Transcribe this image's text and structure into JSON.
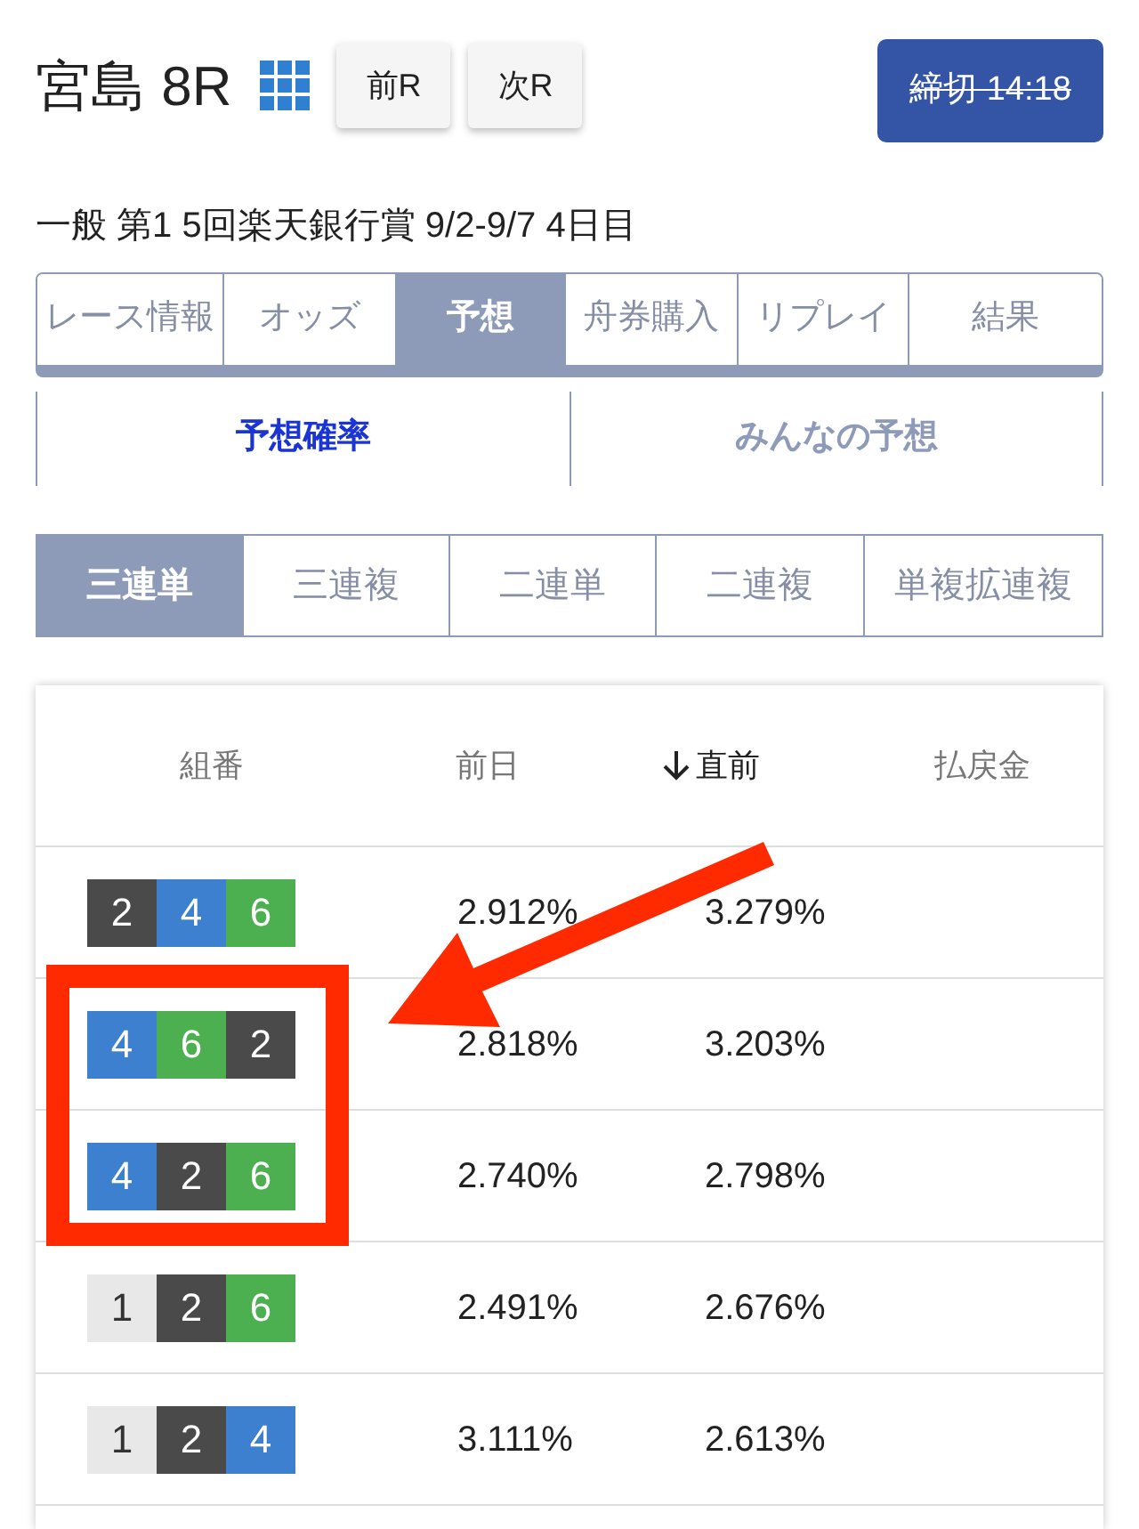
{
  "header": {
    "title": "宮島 8R",
    "nav_buttons": [
      "前R",
      "次R"
    ],
    "deadline": {
      "label": "締切 14:18",
      "closed": true
    }
  },
  "race_info": "一般 第1 5回楽天銀行賞 9/2-9/7 4日目",
  "tabs": [
    {
      "label": "レース情報",
      "selected": false
    },
    {
      "label": "オッズ",
      "selected": false
    },
    {
      "label": "予想",
      "selected": true
    },
    {
      "label": "舟券購入",
      "selected": false
    },
    {
      "label": "リプレイ",
      "selected": false
    },
    {
      "label": "結果",
      "selected": false
    }
  ],
  "sub_tabs": [
    {
      "label": "予想確率",
      "selected": true
    },
    {
      "label": "みんなの予想",
      "selected": false
    }
  ],
  "bet_types": [
    {
      "label": "三連単",
      "selected": true
    },
    {
      "label": "三連複",
      "selected": false
    },
    {
      "label": "二連単",
      "selected": false
    },
    {
      "label": "二連複",
      "selected": false
    },
    {
      "label": "単複拡連複",
      "selected": false
    }
  ],
  "table": {
    "columns": [
      {
        "label": "組番",
        "sorted": false
      },
      {
        "label": "前日",
        "sorted": false
      },
      {
        "label": "直前",
        "sorted": true
      },
      {
        "label": "払戻金",
        "sorted": false
      }
    ],
    "rows": [
      {
        "boats": [
          {
            "number": "2",
            "color": "#4a4a4a"
          },
          {
            "number": "4",
            "color": "#3d80d0"
          },
          {
            "number": "6",
            "color": "#4caf50"
          }
        ],
        "previous_day": "2.912%",
        "latest": "3.279%",
        "highlighted": false
      },
      {
        "boats": [
          {
            "number": "4",
            "color": "#3d80d0"
          },
          {
            "number": "6",
            "color": "#4caf50"
          },
          {
            "number": "2",
            "color": "#4a4a4a"
          }
        ],
        "previous_day": "2.818%",
        "latest": "3.203%",
        "highlighted": true
      },
      {
        "boats": [
          {
            "number": "4",
            "color": "#3d80d0"
          },
          {
            "number": "2",
            "color": "#4a4a4a"
          },
          {
            "number": "6",
            "color": "#4caf50"
          }
        ],
        "previous_day": "2.740%",
        "latest": "2.798%",
        "highlighted": true
      },
      {
        "boats": [
          {
            "number": "1",
            "color": "#e8e8e8"
          },
          {
            "number": "2",
            "color": "#4a4a4a"
          },
          {
            "number": "6",
            "color": "#4caf50"
          }
        ],
        "previous_day": "2.491%",
        "latest": "2.676%",
        "highlighted": false
      },
      {
        "boats": [
          {
            "number": "1",
            "color": "#e8e8e8"
          },
          {
            "number": "2",
            "color": "#4a4a4a"
          },
          {
            "number": "4",
            "color": "#3d80d0"
          }
        ],
        "previous_day": "3.111%",
        "latest": "2.613%",
        "highlighted": false
      }
    ]
  }
}
